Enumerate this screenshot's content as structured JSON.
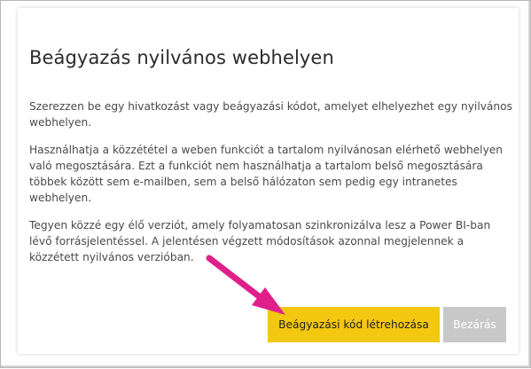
{
  "dialog": {
    "title": "Beágyazás nyilvános webhelyen",
    "paragraphs": [
      "Szerezzen be egy hivatkozást vagy beágyazási kódot, amelyet elhelyezhet egy nyilvános webhelyen.",
      "Használhatja a közzététel a weben funkciót a tartalom nyilvánosan elérhető webhelyen való megosztására. Ezt a funkciót nem használhatja a tartalom belső megosztására többek között sem e-mailben, sem a belső hálózaton sem pedig egy intranetes webhelyen.",
      "Tegyen közzé egy élő verziót, amely folyamatosan szinkronizálva lesz a Power BI-ban lévő forrásjelentéssel. A jelentésen végzett módosítások azonnal megjelennek a közzétett nyilvános verzióban."
    ],
    "primary_button": "Beágyazási kód létrehozása",
    "close_button": "Bezárás"
  },
  "colors": {
    "primary_button": "#f2c811",
    "close_button": "#c8c8c8",
    "annotation_arrow": "#e0208a"
  }
}
